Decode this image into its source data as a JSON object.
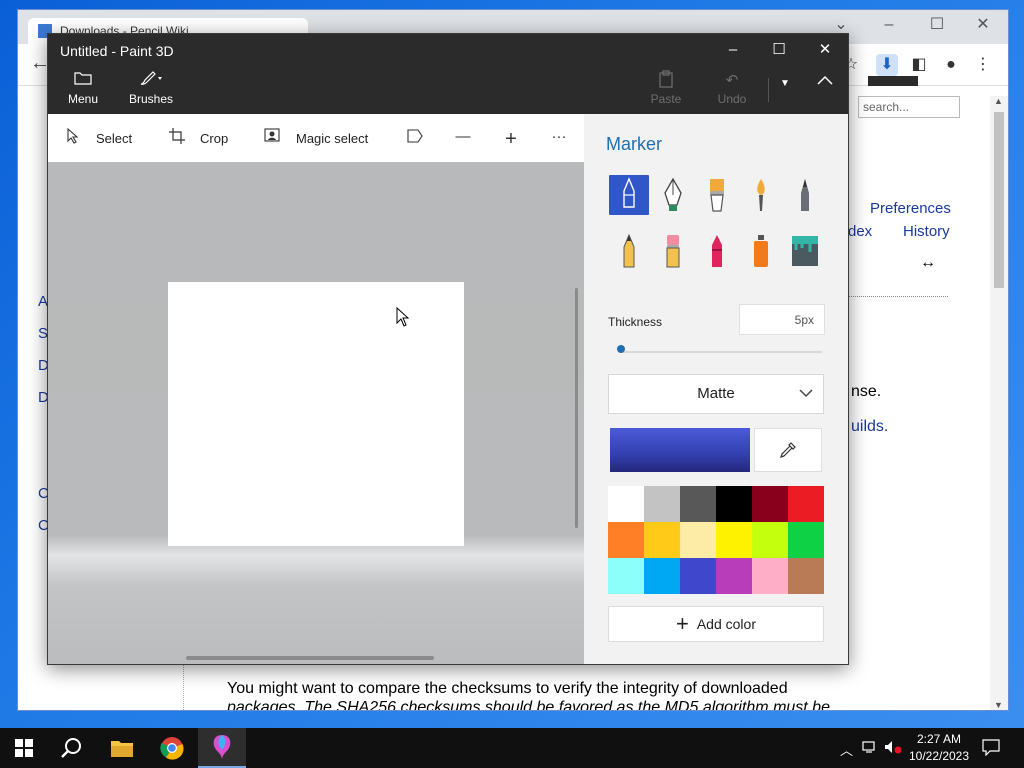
{
  "browser": {
    "tab_title": "Downloads - Pencil Wiki",
    "wiki": {
      "search_placeholder": "search...",
      "preferences": "Preferences",
      "index": "dex",
      "history": "History",
      "arrow": "↔",
      "left_letters": [
        "A",
        "S",
        "D",
        "D",
        "C",
        "C"
      ],
      "fragment1": "nse.",
      "fragment2": "uilds.",
      "para_line1": "You might want to compare the checksums to verify the integrity of downloaded",
      "para_line2": "packages. The SHA256 checksums should be favored as the MD5 algorithm must be"
    }
  },
  "paint3d": {
    "title": "Untitled - Paint 3D",
    "header": {
      "menu_label": "Menu",
      "brushes_label": "Brushes",
      "paste_label": "Paste",
      "undo_label": "Undo"
    },
    "toolbar": {
      "select_label": "Select",
      "crop_label": "Crop",
      "magic_select_label": "Magic select",
      "more": "···"
    },
    "panel": {
      "title": "Marker",
      "brushes": [
        "marker",
        "calligraphy-pen",
        "oil-brush",
        "watercolor",
        "pixel-pen",
        "pencil",
        "eraser",
        "crayon",
        "spray-can",
        "fill"
      ],
      "selected_brush": "marker",
      "thickness_label": "Thickness",
      "thickness_value": "5px",
      "thickness_level": 0.05,
      "finish": "Matte",
      "current_color": "#3340b0",
      "add_color_label": "Add color",
      "palette": [
        "#ffffff",
        "#c3c3c3",
        "#585858",
        "#000000",
        "#88001b",
        "#ec1c24",
        "#ff7f27",
        "#ffca18",
        "#fdeca6",
        "#fff200",
        "#c4ff0e",
        "#0ed145",
        "#8cfffb",
        "#00a8f3",
        "#3f48cc",
        "#b83dba",
        "#ffaec8",
        "#b97a56"
      ]
    }
  },
  "taskbar": {
    "time": "2:27 AM",
    "date": "10/22/2023"
  }
}
